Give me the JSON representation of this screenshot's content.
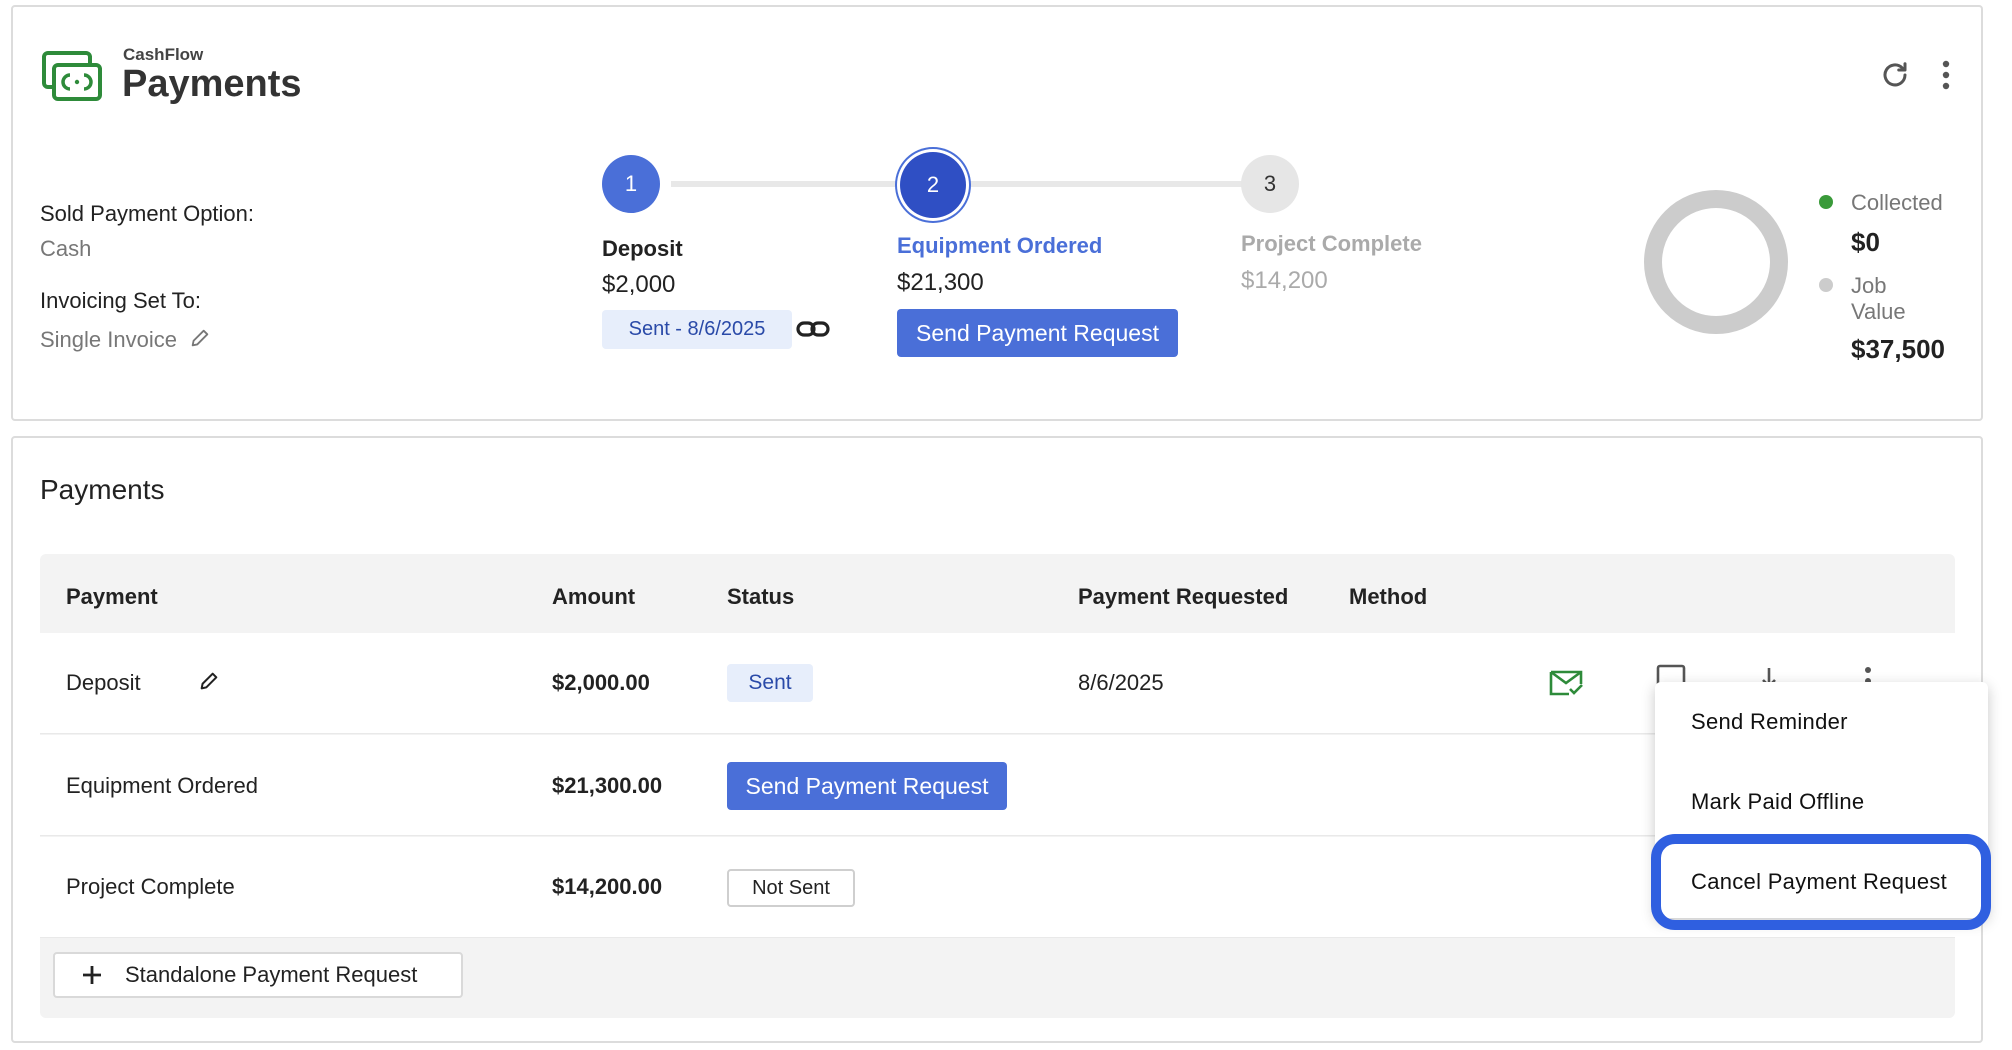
{
  "header": {
    "brand_sub": "CashFlow",
    "title": "Payments",
    "refresh_icon": "refresh-icon",
    "more_icon": "more-vertical-icon"
  },
  "info": {
    "sold_label": "Sold Payment Option:",
    "sold_value": "Cash",
    "invoicing_label": "Invoicing Set To:",
    "invoicing_value": "Single Invoice"
  },
  "stepper": {
    "steps": [
      {
        "number": "1",
        "name": "Deposit",
        "amount": "$2,000",
        "chip": "Sent - 8/6/2025"
      },
      {
        "number": "2",
        "name": "Equipment Ordered",
        "amount": "$21,300",
        "button": "Send Payment Request"
      },
      {
        "number": "3",
        "name": "Project Complete",
        "amount": "$14,200"
      }
    ]
  },
  "summary": {
    "collected_label": "Collected",
    "collected_value": "$0",
    "job_value_label_1": "Job",
    "job_value_label_2": "Value",
    "job_value": "$37,500",
    "collected_color": "#3a9a3a",
    "job_color": "#cccccc"
  },
  "payments": {
    "title": "Payments",
    "columns": [
      "Payment",
      "Amount",
      "Status",
      "Payment Requested",
      "Method"
    ],
    "rows": [
      {
        "payment": "Deposit",
        "amount": "$2,000.00",
        "status": "Sent",
        "requested": "8/6/2025",
        "method": ""
      },
      {
        "payment": "Equipment Ordered",
        "amount": "$21,300.00",
        "status_button": "Send Payment Request",
        "requested": "",
        "method": ""
      },
      {
        "payment": "Project Complete",
        "amount": "$14,200.00",
        "status": "Not Sent",
        "requested": "",
        "method": ""
      }
    ],
    "standalone_button": "Standalone Payment Request"
  },
  "menu": {
    "items": [
      "Send Reminder",
      "Mark Paid Offline",
      "Cancel Payment Request"
    ]
  },
  "colors": {
    "accent": "#4a6fd8",
    "accent_dark": "#2f4fc4",
    "brand_green": "#2e8b3a",
    "highlight": "#2f5fe0"
  }
}
